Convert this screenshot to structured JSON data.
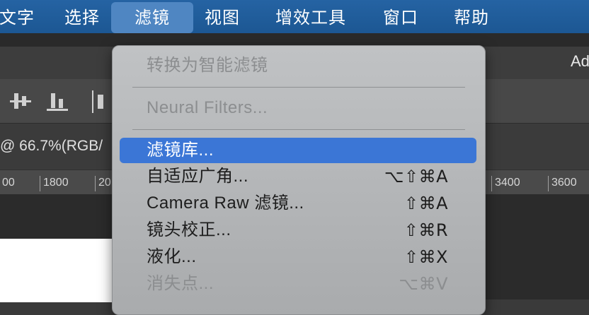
{
  "menubar": {
    "items": [
      "文字",
      "选择",
      "滤镜",
      "视图",
      "增效工具",
      "窗口",
      "帮助"
    ],
    "active_index": 2
  },
  "tabbar": {
    "partial_text": "Ad"
  },
  "document": {
    "title": "@ 66.7%(RGB/"
  },
  "ruler": {
    "ticks": [
      "00",
      "1800",
      "20",
      "3400",
      "3600"
    ]
  },
  "filter_menu": {
    "items": [
      {
        "label": "转换为智能滤镜",
        "shortcut": "",
        "enabled": false
      },
      {
        "label": "Neural Filters...",
        "shortcut": "",
        "enabled": false
      },
      {
        "label": "滤镜库...",
        "shortcut": "",
        "enabled": true,
        "highlighted": true
      },
      {
        "label": "自适应广角...",
        "shortcut": "⌥⇧⌘A",
        "enabled": true
      },
      {
        "label": "Camera Raw 滤镜...",
        "shortcut": "⇧⌘A",
        "enabled": true
      },
      {
        "label": "镜头校正...",
        "shortcut": "⇧⌘R",
        "enabled": true
      },
      {
        "label": "液化...",
        "shortcut": "⇧⌘X",
        "enabled": true
      },
      {
        "label": "消失点...",
        "shortcut": "⌥⌘V",
        "enabled": false
      }
    ]
  },
  "colors": {
    "menubar_bg": "#2563a3",
    "highlight": "#3b76d6",
    "menu_bg": "#b8babc"
  },
  "icons": [
    "align-vertical-center-icon",
    "align-bottom-icon",
    "distribute-icon"
  ]
}
